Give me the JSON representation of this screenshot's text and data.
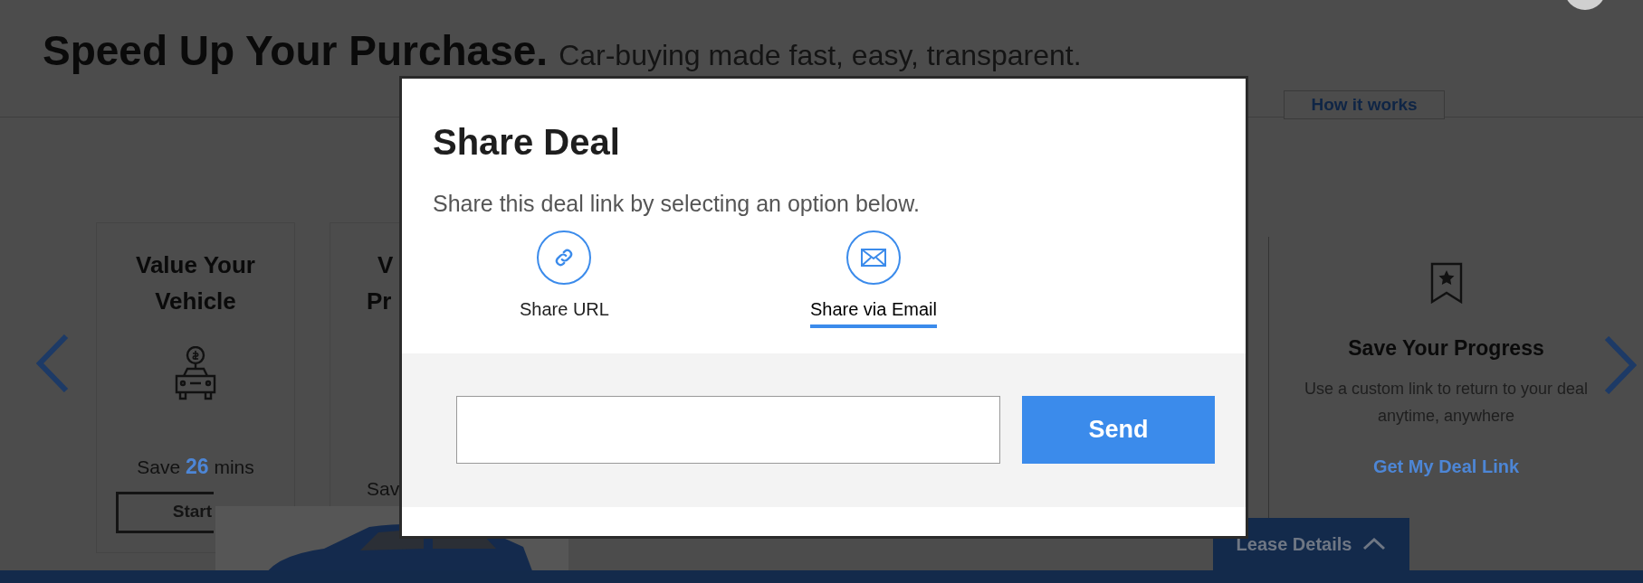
{
  "header": {
    "title": "Speed Up Your Purchase.",
    "tagline": "Car-buying made fast, easy, transparent."
  },
  "nav": {
    "how_it_works": "How it works"
  },
  "cards": [
    {
      "title_lines": [
        "Value Your",
        "Vehicle"
      ],
      "save_prefix": "Save",
      "save_value": "26",
      "save_suffix": "mins",
      "button": "Start"
    },
    {
      "title_lines": [
        "V",
        "Pr"
      ],
      "save_prefix": "Sav"
    }
  ],
  "feature": {
    "title": "Save Your Progress",
    "text": "Use a custom link to return to your deal anytime, anywhere",
    "link": "Get My Deal Link"
  },
  "lease_tab": {
    "label": "Lease Details",
    "expanded": false
  },
  "modal": {
    "title": "Share Deal",
    "subtitle": "Share this deal link by selecting an option below.",
    "options": [
      {
        "kind": "link",
        "label": "Share URL",
        "selected": false
      },
      {
        "kind": "email",
        "label": "Share via Email",
        "selected": true
      }
    ],
    "send_button": "Send"
  }
}
